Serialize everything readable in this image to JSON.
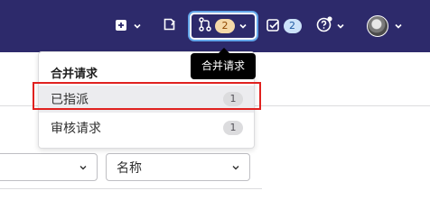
{
  "navbar": {
    "mr_count": "2",
    "issues_count": "2",
    "icons": {
      "create": "plus-square-icon",
      "todo": "todo-icon",
      "merge_request": "merge-request-icon",
      "issues": "issues-check-icon",
      "help": "question-circle-icon",
      "avatar": "user-avatar"
    }
  },
  "tooltip": {
    "text": "合并请求"
  },
  "dropdown": {
    "title": "合并请求",
    "items": [
      {
        "label": "已指派",
        "count": "1"
      },
      {
        "label": "审核请求",
        "count": "1"
      }
    ]
  },
  "filters": {
    "sort_select": {
      "value": "名称"
    },
    "left_select": {
      "value": ""
    }
  },
  "colors": {
    "navbar_bg": "#2d2a6b",
    "mr_badge_bg": "#f5d9a8",
    "issues_badge_bg": "#cbe2f9",
    "highlight": "#e0211f"
  }
}
